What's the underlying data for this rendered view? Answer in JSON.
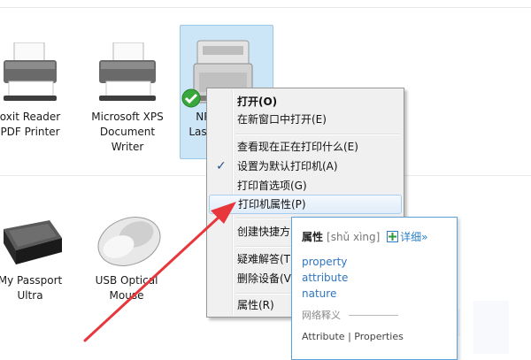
{
  "devices": [
    {
      "label": "oxit Reader\nPDF Printer"
    },
    {
      "label": "Microsoft XPS\nDocument\nWriter"
    },
    {
      "label": "NPI\nLase"
    },
    {
      "label": "My Passport\nUltra"
    },
    {
      "label": "USB Optical\nMouse"
    }
  ],
  "context_menu": {
    "items": [
      {
        "label": "打开(O)"
      },
      {
        "label": "在新窗口中打开(E)"
      },
      {
        "label": "查看现在正在打印什么(E)"
      },
      {
        "label": "设置为默认打印机(A)"
      },
      {
        "label": "打印首选项(G)"
      },
      {
        "label": "打印机属性(P)"
      },
      {
        "label": "创建快捷方"
      },
      {
        "label": "疑难解答(T"
      },
      {
        "label": "删除设备(V"
      },
      {
        "label": "属性(R)"
      }
    ],
    "check_mark": "✓"
  },
  "dictionary": {
    "word": "属性",
    "pinyin": "[shǔ xìng]",
    "more": "详细»",
    "definitions": [
      "property",
      "attribute",
      "nature"
    ],
    "net_label": "网络释义",
    "net_text": "Attribute | Properties"
  },
  "colors": {
    "accent": "#5ca3dc",
    "arrow": "#e8373c",
    "selection": "#cde6f7"
  }
}
